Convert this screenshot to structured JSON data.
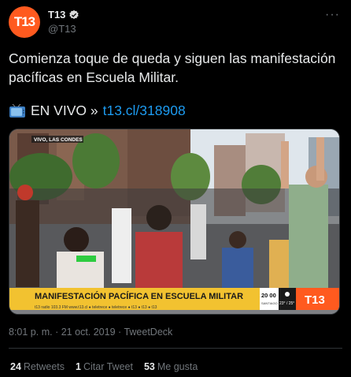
{
  "author": {
    "avatar_text": "T13",
    "display_name": "T13",
    "handle": "@T13",
    "verified": true,
    "brand_color": "#ff5a1f"
  },
  "more_icon": "more-horizontal-icon",
  "tweet": {
    "text": "Comienza toque de queda y siguen las manifestación pacíficas en Escuela Militar.",
    "live_prefix": "EN VIVO »",
    "live_icon": "television-icon",
    "link": "t13.cl/318908"
  },
  "media": {
    "overlay_top_left": "VIVO, LAS CONDES",
    "banner_text": "MANIFESTACIÓN PACÍFICA EN ESCUELA MILITAR",
    "ticker_text": "t13 radio 103.3 FM   www.t13.cl   ● teletrece  ● teletrece  ● t13  ● t13   ● t13",
    "time": "20 00",
    "location": "SANTIAGO",
    "temperature": "23° / 25°",
    "channel_logo": "T13",
    "banner_color": "#f2c230",
    "logo_color": "#ff5a1f"
  },
  "meta": {
    "time": "8:01 p. m.",
    "date": "21 oct. 2019",
    "source": "TweetDeck",
    "separator": "·"
  },
  "stats": {
    "retweets_count": "24",
    "retweets_label": "Retweets",
    "quotes_count": "1",
    "quotes_label": "Citar Tweet",
    "likes_count": "53",
    "likes_label": "Me gusta"
  }
}
